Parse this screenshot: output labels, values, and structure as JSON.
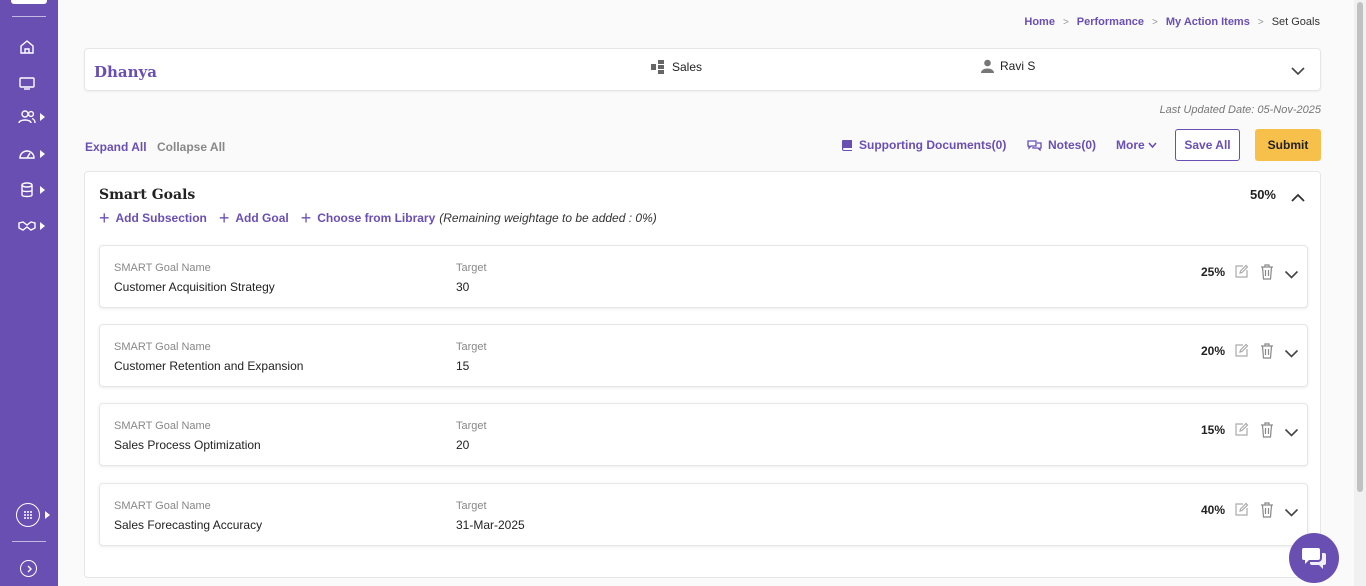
{
  "breadcrumb": {
    "home": "Home",
    "performance": "Performance",
    "action_items": "My Action Items",
    "current": "Set Goals"
  },
  "employee": {
    "name": "Dhanya",
    "department": "Sales",
    "manager": "Ravi S"
  },
  "last_updated": "Last Updated Date: 05-Nov-2025",
  "toolbar": {
    "expand_all": "Expand All",
    "collapse_all": "Collapse All",
    "supporting_docs": "Supporting Documents(0)",
    "notes": "Notes(0)",
    "more": "More",
    "save_all": "Save All",
    "submit": "Submit"
  },
  "section": {
    "title": "Smart Goals",
    "percent": "50%",
    "add_subsection": "Add Subsection",
    "add_goal": "Add Goal",
    "choose_library": "Choose from Library",
    "remaining_note": "(Remaining weightage to be added : 0%)"
  },
  "goal_labels": {
    "name": "SMART Goal Name",
    "target": "Target"
  },
  "goals": [
    {
      "name": "Customer Acquisition Strategy",
      "target": "30",
      "weight": "25%"
    },
    {
      "name": "Customer Retention and Expansion",
      "target": "15",
      "weight": "20%"
    },
    {
      "name": "Sales Process Optimization",
      "target": "20",
      "weight": "15%"
    },
    {
      "name": "Sales Forecasting Accuracy",
      "target": "31-Mar-2025",
      "weight": "40%"
    }
  ],
  "colors": {
    "brand": "#6a4fb3",
    "submit": "#f7c04a"
  }
}
